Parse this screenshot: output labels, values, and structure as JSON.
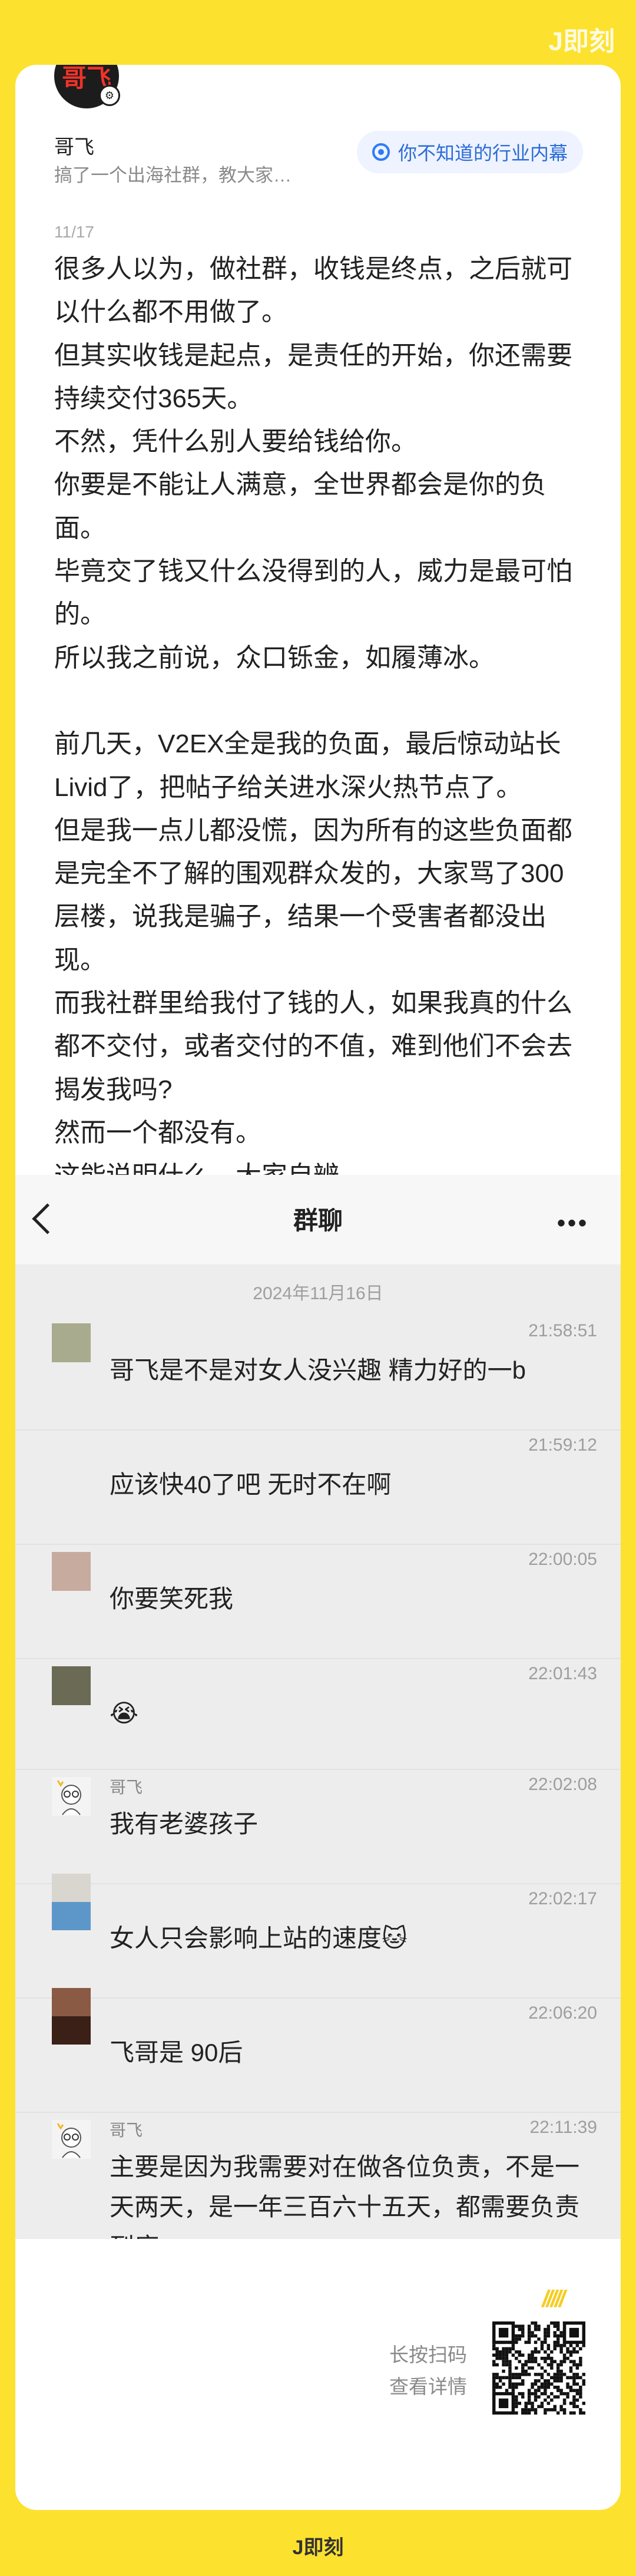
{
  "brand": {
    "top": "J即刻",
    "bottom": "J即刻"
  },
  "post": {
    "author": "哥飞",
    "avatar_text": "哥飞",
    "bio": "搞了一个出海社群，教大家…",
    "topic": "你不知道的行业内幕",
    "date": "11/17",
    "lines": [
      "很多人以为，做社群，收钱是终点，之后就可",
      "以什么都不用做了。",
      "但其实收钱是起点，是责任的开始，你还需要",
      "持续交付365天。",
      "不然，凭什么别人要给钱给你。",
      "你要是不能让人满意，全世界都会是你的负",
      "面。",
      "毕竟交了钱又什么没得到的人，威力是最可怕",
      "的。",
      "所以我之前说，众口铄金，如履薄冰。",
      "",
      "前几天，V2EX全是我的负面，最后惊动站长",
      "Livid了，把帖子给关进水深火热节点了。",
      "但是我一点儿都没慌，因为所有的这些负面都",
      "是完全不了解的围观群众发的，大家骂了300",
      "层楼，说我是骗子，结果一个受害者都没出",
      "现。",
      "而我社群里给我付了钱的人，如果我真的什么",
      "都不交付，或者交付的不值，难到他们不会去",
      "揭发我吗?",
      "然而一个都没有。",
      "这能说明什么，大家自辨。"
    ]
  },
  "chat": {
    "title": "群聊",
    "more": "•••",
    "date": "2024年11月16日",
    "messages": [
      {
        "time": "21:58:51",
        "name": "",
        "text": "哥飞是不是对女人没兴趣 精力好的一b",
        "avatar": "#a8ab8e"
      },
      {
        "time": "21:59:12",
        "name": "",
        "text": "应该快40了吧 无时不在啊",
        "avatar": ""
      },
      {
        "time": "22:00:05",
        "name": "",
        "text": "你要笑死我",
        "avatar": "#c7ab9e"
      },
      {
        "time": "22:01:43",
        "name": "",
        "text": "😭",
        "avatar": "#6b6b55"
      },
      {
        "time": "22:02:08",
        "name": "哥飞",
        "text": "我有老婆孩子",
        "avatar": "cartoon"
      },
      {
        "time": "22:02:17",
        "name": "",
        "text": "女人只会影响上站的速度🐱",
        "avatar": "split-blue"
      },
      {
        "time": "22:06:20",
        "name": "",
        "text": "飞哥是 90后",
        "avatar": "split-brown"
      },
      {
        "time": "22:11:39",
        "name": "哥飞",
        "text": "主要是因为我需要对在做各位负责，不是一天两天，是一年三百六十五天，都需要负责到底。",
        "avatar": "cartoon"
      }
    ]
  },
  "qr": {
    "stripes": "/////",
    "line1": "长按扫码",
    "line2": "查看详情"
  },
  "colors": {
    "background": "#fde12f",
    "accent": "#2d7cf6",
    "card": "#ffffff",
    "chat_bg": "#ededed"
  }
}
